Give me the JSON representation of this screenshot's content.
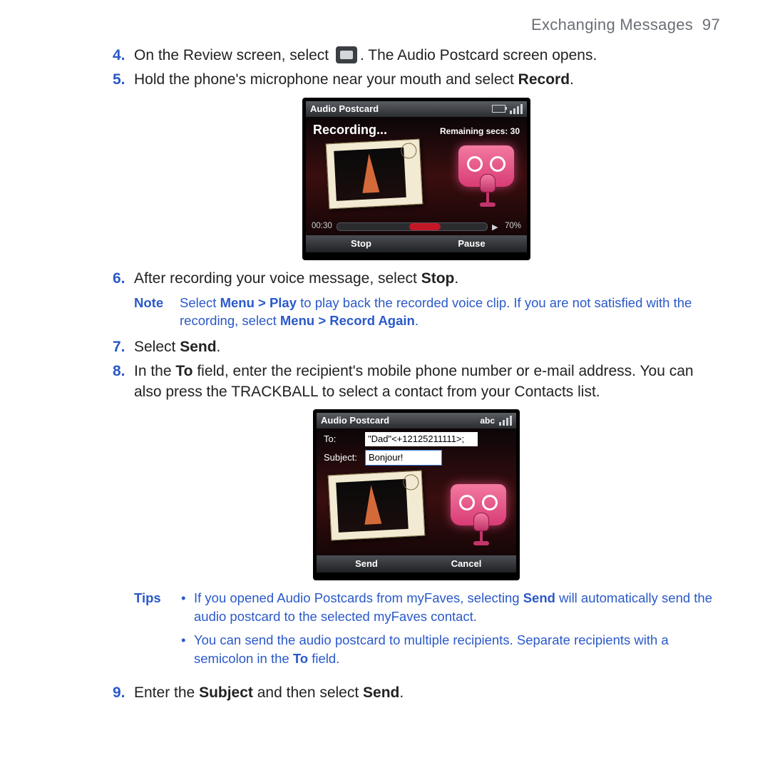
{
  "header": {
    "section": "Exchanging Messages",
    "page": "97"
  },
  "steps": {
    "s4": {
      "num": "4.",
      "pre": "On the Review screen, select ",
      "post": ". The Audio Postcard screen opens."
    },
    "s5": {
      "num": "5.",
      "pre": "Hold the phone's microphone near your mouth and select ",
      "bold": "Record",
      "post": "."
    },
    "s6": {
      "num": "6.",
      "pre": "After recording your voice message, select ",
      "bold": "Stop",
      "post": "."
    },
    "s7": {
      "num": "7.",
      "pre": "Select ",
      "bold": "Send",
      "post": "."
    },
    "s8": {
      "num": "8.",
      "t1": "In the ",
      "b1": "To",
      "t2": " field, enter the recipient's mobile phone number or e-mail address. You can also press the TRACKBALL to select a contact from your Contacts list."
    },
    "s9": {
      "num": "9.",
      "t1": "Enter the ",
      "b1": "Subject",
      "t2": " and then select ",
      "b2": "Send",
      "t3": "."
    }
  },
  "note": {
    "label": "Note",
    "t1": "Select ",
    "b1": "Menu > Play",
    "t2": " to play back the recorded voice clip. If you are not satisfied with the recording, select ",
    "b2": "Menu > Record Again",
    "t3": "."
  },
  "tips": {
    "label": "Tips",
    "i1": {
      "t1": "If you opened Audio Postcards from myFaves, selecting ",
      "b1": "Send",
      "t2": " will automatically send the audio postcard to the selected myFaves contact."
    },
    "i2": {
      "t1": "You can send the audio postcard to multiple recipients. Separate recipients with a semicolon in the ",
      "b1": "To",
      "t2": " field."
    }
  },
  "shot1": {
    "title": "Audio Postcard",
    "recording": "Recording...",
    "remaining": "Remaining secs: 30",
    "elapsed": "00:30",
    "volume": "70%",
    "left": "Stop",
    "right": "Pause"
  },
  "shot2": {
    "title": "Audio Postcard",
    "mode": "abc",
    "to_label": "To:",
    "to_value": "\"Dad\"<+12125211111>;",
    "subject_label": "Subject:",
    "subject_value": "Bonjour!",
    "left": "Send",
    "right": "Cancel"
  }
}
